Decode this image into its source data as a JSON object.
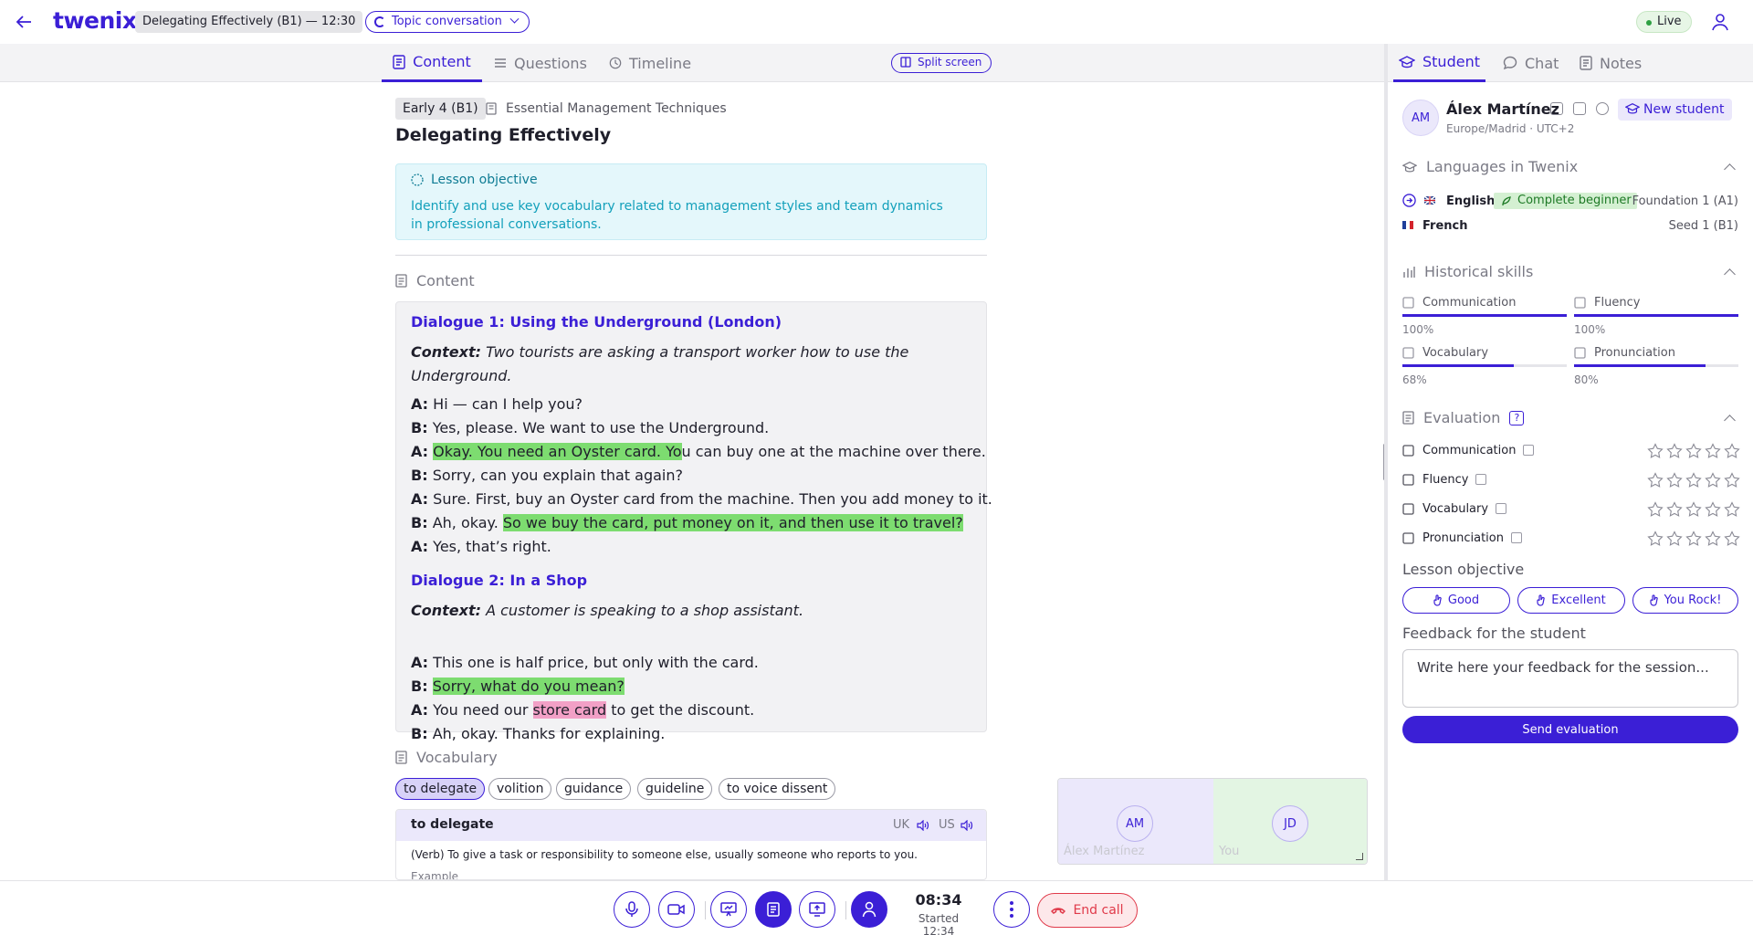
{
  "app": {
    "logo": "twenix"
  },
  "header": {
    "lesson_chip": "Delegating Effectively (B1) — 12:30",
    "topic_chip": "Topic conversation",
    "live_label": "Live"
  },
  "tabs": [
    {
      "label": "Content",
      "icon": "document-icon",
      "active": true
    },
    {
      "label": "Questions",
      "icon": "list-icon",
      "active": false
    },
    {
      "label": "Timeline",
      "icon": "clock-icon",
      "active": false
    }
  ],
  "split_screen_label": "Split screen",
  "lesson": {
    "level": "Early 4 (B1)",
    "course": "Essential Management Techniques",
    "title": "Delegating Effectively",
    "objective_heading": "Lesson objective",
    "objective_text": "Identify and use key vocabulary related to management styles and team dynamics in professional conversations."
  },
  "content": {
    "heading": "Content",
    "dialogue1": {
      "title": "Dialogue 1: Using the Underground (London)",
      "context_label": "Context:",
      "context": "Two tourists are asking a transport worker how to use the Underground.",
      "lines": [
        {
          "speaker": "A:",
          "pre": "Hi — can I help you?",
          "hl": "",
          "post": ""
        },
        {
          "speaker": "B:",
          "pre": "Yes, please. We want to use the Underground.",
          "hl": "",
          "post": ""
        },
        {
          "speaker": "A:",
          "pre": "",
          "hl": "Okay. You need an Oyster card. Yo",
          "post": "u can buy one at the machine over there."
        },
        {
          "speaker": "B:",
          "pre": "Sorry, can you explain that again?",
          "hl": "",
          "post": ""
        },
        {
          "speaker": "A:",
          "pre": "Sure. First, buy an Oyster card from the machine. Then you add money to it.",
          "hl": "",
          "post": ""
        },
        {
          "speaker": "B:",
          "pre": "Ah, okay. ",
          "hl": "So we buy the card, put money on it, and then use it to travel?",
          "post": ""
        },
        {
          "speaker": "A:",
          "pre": "Yes, that’s right.",
          "hl": "",
          "post": ""
        }
      ]
    },
    "dialogue2": {
      "title": "Dialogue 2: In a Shop",
      "context_label": "Context:",
      "context": "A customer is speaking to a shop assistant.",
      "lines": [
        {
          "speaker": "A:",
          "pre": "This one is half price, but only with the card.",
          "hl": "",
          "post": ""
        },
        {
          "speaker": "B:",
          "pre": "",
          "hl": "Sorry, what do you mean?",
          "post": ""
        },
        {
          "speaker": "A:",
          "pre": "You need our ",
          "hl": "store card",
          "post": " to get the discount."
        },
        {
          "speaker": "B:",
          "pre": "Ah, okay. Thanks for explaining.",
          "hl": "",
          "post": ""
        }
      ]
    }
  },
  "vocabulary": {
    "heading": "Vocabulary",
    "chips": [
      "to delegate",
      "volition",
      "guidance",
      "guideline",
      "to voice dissent"
    ],
    "card": {
      "word": "to delegate",
      "uk": "UK",
      "us": "US",
      "definition": "(Verb) To give a task or responsibility to someone else, usually someone who reports to you.",
      "example_label": "Example"
    }
  },
  "video": {
    "student_initials": "AM",
    "student_name": "Álex Martínez",
    "teacher_initials": "JD",
    "teacher_name": "You"
  },
  "controls": {
    "timer": "08:34",
    "started": "Started 12:34",
    "end_call": "End call"
  },
  "right_tabs": [
    {
      "label": "Student",
      "active": true
    },
    {
      "label": "Chat",
      "active": false
    },
    {
      "label": "Notes",
      "active": false
    }
  ],
  "student": {
    "initials": "AM",
    "name": "Álex Martínez",
    "timezone": "Europe/Madrid · UTC+2",
    "new_student_label": "New student"
  },
  "languages": {
    "heading": "Languages in Twenix",
    "items": [
      {
        "name": "English",
        "badge": "Complete beginner",
        "level": "Foundation 1 (A1)"
      },
      {
        "name": "French",
        "badge": "",
        "level": "Seed 1 (B1)"
      }
    ]
  },
  "skills": {
    "heading": "Historical skills",
    "items": [
      {
        "name": "Communication",
        "pct_label": "100%",
        "value": 1.0
      },
      {
        "name": "Fluency",
        "pct_label": "100%",
        "value": 1.0
      },
      {
        "name": "Vocabulary",
        "pct_label": "68%",
        "value": 0.68
      },
      {
        "name": "Pronunciation",
        "pct_label": "80%",
        "value": 0.8
      }
    ]
  },
  "evaluation": {
    "heading": "Evaluation",
    "help": "?",
    "items": [
      {
        "name": "Communication",
        "stars": 0
      },
      {
        "name": "Fluency",
        "stars": 0
      },
      {
        "name": "Vocabulary",
        "stars": 0
      },
      {
        "name": "Pronunciation",
        "stars": 0
      }
    ],
    "objective_label": "Lesson objective",
    "objective_buttons": [
      "Good",
      "Excellent",
      "You Rock!"
    ],
    "feedback_label": "Feedback for the student",
    "feedback_placeholder": "Write here your feedback for the session...",
    "send_label": "Send evaluation"
  },
  "colors": {
    "accent": "#3b1fd6",
    "highlight_green": "#7ddc70",
    "highlight_pink": "#f2a0c6",
    "danger": "#e03a4a"
  }
}
